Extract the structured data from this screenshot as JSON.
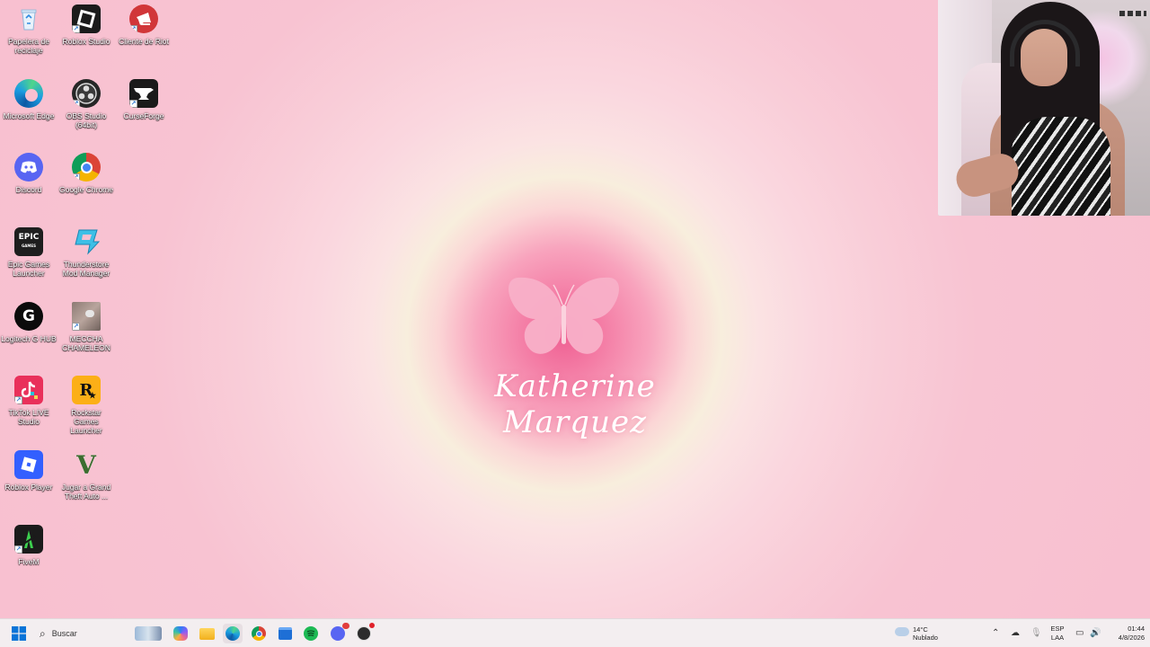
{
  "desktop": {
    "icons": [
      {
        "label": "Papelera de\nreciclaje",
        "icon": "recycle-bin-icon"
      },
      {
        "label": "Roblox Studio",
        "icon": "roblox-studio-icon"
      },
      {
        "label": "Cliente de Riot",
        "icon": "riot-client-icon"
      },
      {
        "label": "Microsoft Edge",
        "icon": "edge-icon"
      },
      {
        "label": "OBS Studio\n(64bit)",
        "icon": "obs-icon"
      },
      {
        "label": "CurseForge",
        "icon": "curseforge-icon"
      },
      {
        "label": "Discord",
        "icon": "discord-icon"
      },
      {
        "label": "Google Chrome",
        "icon": "chrome-icon"
      },
      {
        "label": "Epic Games\nLauncher",
        "icon": "epic-games-icon",
        "text": "EPIC"
      },
      {
        "label": "Thunderstore\nMod Manager",
        "icon": "thunderstore-icon"
      },
      {
        "label": "Logitech G HUB",
        "icon": "logitech-ghub-icon",
        "text": "G"
      },
      {
        "label": "MECCHA\nCHAMELEON",
        "icon": "meccha-chameleon-icon"
      },
      {
        "label": "TikTok LIVE\nStudio",
        "icon": "tiktok-live-icon"
      },
      {
        "label": "Rockstar Games\nLauncher",
        "icon": "rockstar-icon",
        "text": "R"
      },
      {
        "label": "Roblox Player",
        "icon": "roblox-player-icon"
      },
      {
        "label": "Jugar a Grand\nTheft Auto ...",
        "icon": "gta-icon",
        "text": "V"
      },
      {
        "label": "FiveM",
        "icon": "fivem-icon"
      }
    ]
  },
  "wallpaper": {
    "name": "Katherine Marquez",
    "logo": "butterfly-icon"
  },
  "taskbar": {
    "search_placeholder": "Buscar",
    "apps": [
      "copilot-icon",
      "file-explorer-icon",
      "edge-icon",
      "chrome-icon",
      "store-icon",
      "spotify-icon",
      "discord-icon",
      "obs-icon"
    ],
    "weather": {
      "temp": "14°C",
      "condition": "Nublado"
    },
    "language": {
      "line1": "ESP",
      "line2": "LAA"
    },
    "clock": {
      "time": "01:44",
      "date": "4/8/2026"
    }
  }
}
